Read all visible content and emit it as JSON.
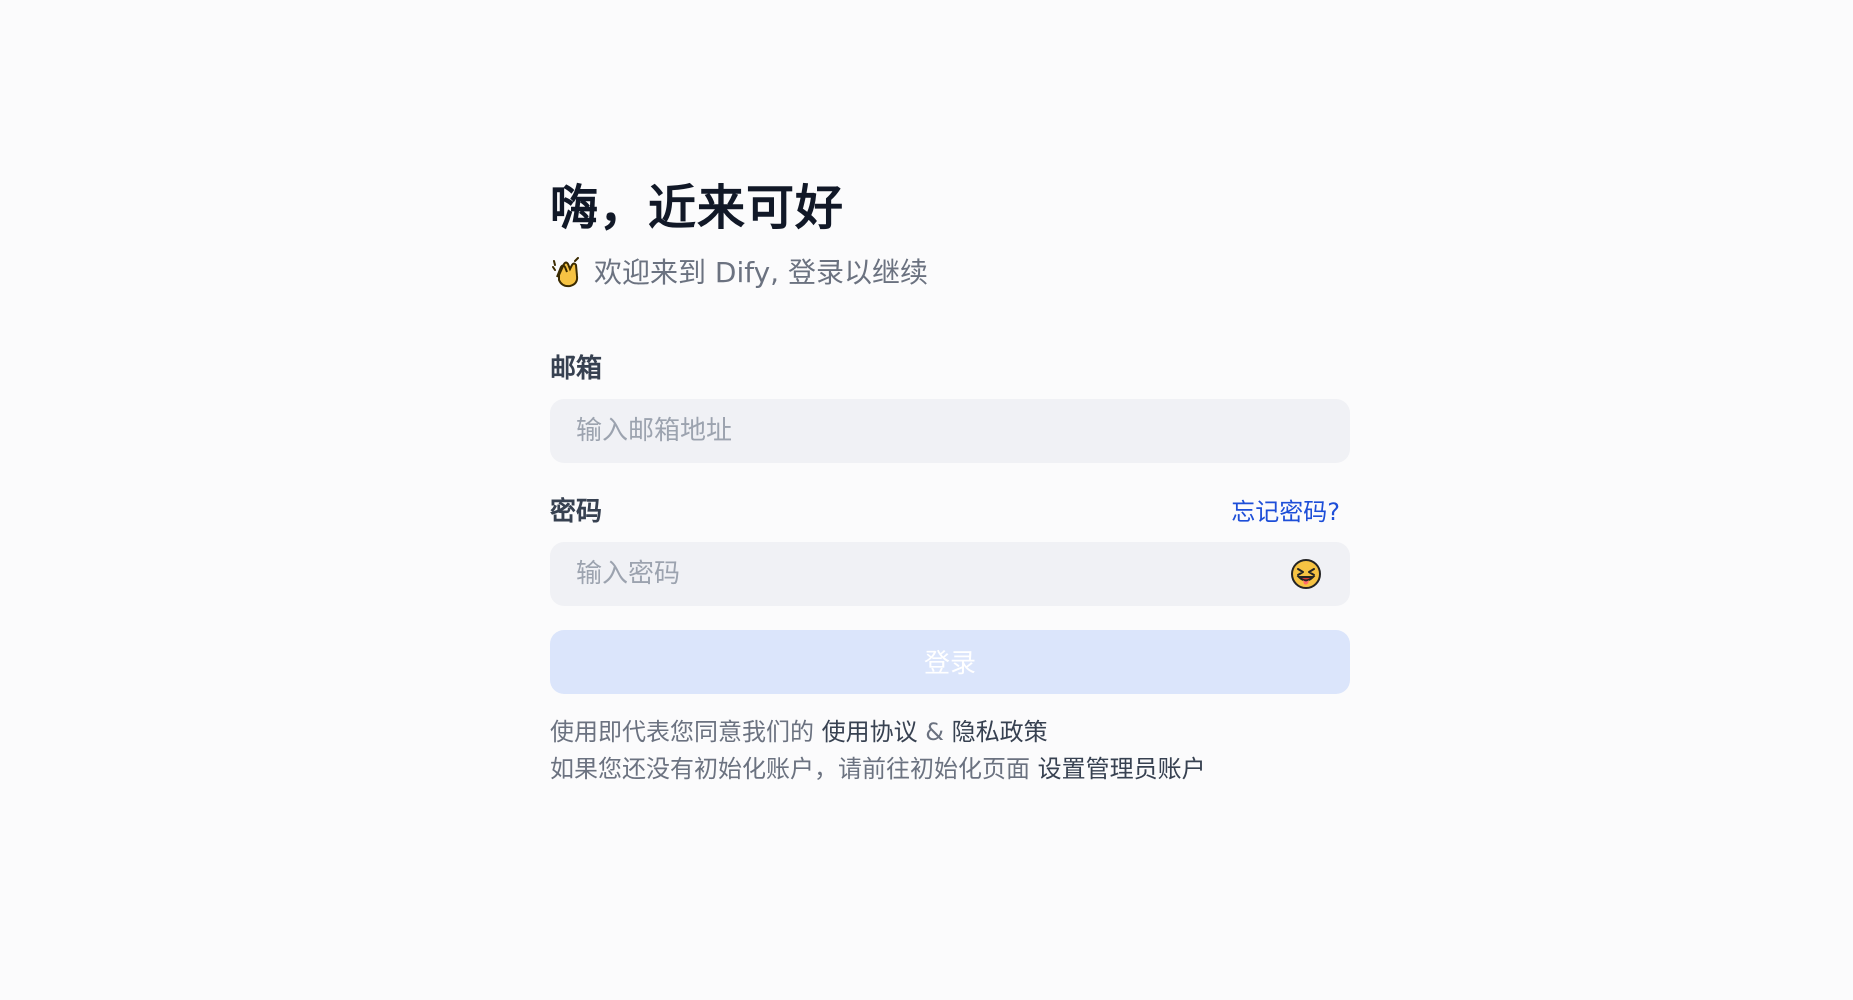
{
  "login": {
    "title": "嗨，近来可好",
    "subtitle_icon": "clapping-hands-icon",
    "subtitle": "欢迎来到 Dify, 登录以继续",
    "email": {
      "label": "邮箱",
      "placeholder": "输入邮箱地址"
    },
    "password": {
      "label": "密码",
      "placeholder": "输入密码",
      "forgot": "忘记密码?",
      "toggle_icon": "laughing-face-icon"
    },
    "submit": "登录",
    "terms_prefix": "使用即代表您同意我们的",
    "terms_link": "使用协议",
    "terms_separator": "&",
    "privacy_link": "隐私政策",
    "init_prefix": "如果您还没有初始化账户，请前往初始化页面",
    "init_link": "设置管理员账户"
  },
  "colors": {
    "background": "#fbfbfc",
    "title": "#111827",
    "muted_text": "#6b7280",
    "label_text": "#374151",
    "input_background": "#f0f1f5",
    "link": "#1d4ed8",
    "disabled_button": "#dbe5fb",
    "emoji_yellow": "#f6c343"
  }
}
